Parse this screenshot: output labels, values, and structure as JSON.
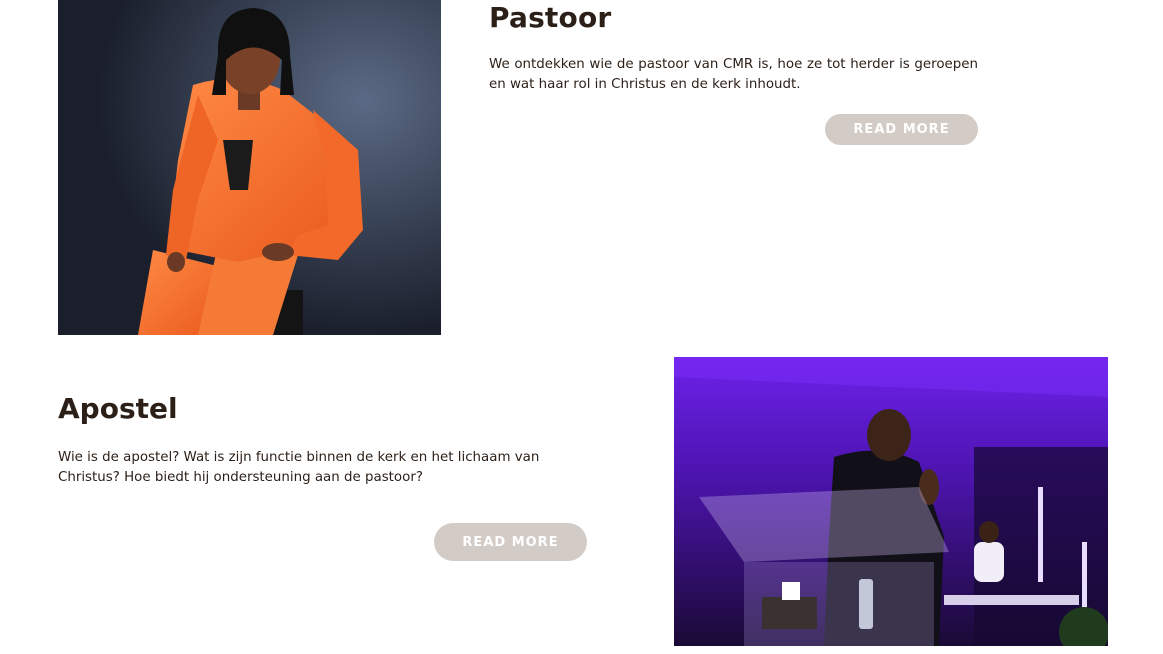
{
  "sections": {
    "pastor": {
      "title": "Pastoor",
      "description": "We ontdekken wie de pastoor van CMR is, hoe ze tot herder is geroepen en wat haar rol in Christus en  de kerk inhoudt.",
      "button_label": "READ MORE",
      "image_subject": "woman in orange suit seated on stool"
    },
    "apostle": {
      "title": "Apostel",
      "description": "Wie is de apostel? Wat is zijn functie binnen de kerk en het lichaam van Christus? Hoe biedt hij ondersteuning aan de pastoor?",
      "button_label": "READ MORE",
      "image_subject": "man preaching at clear lectern with purple stage lighting"
    }
  },
  "colors": {
    "heading": "#2b1f17",
    "body_text": "#2b1f17",
    "button_bg": "#d3cbc6",
    "button_text": "#ffffff",
    "pastor_suit": "#f4712f",
    "stage_purple": "#5a17c9"
  }
}
